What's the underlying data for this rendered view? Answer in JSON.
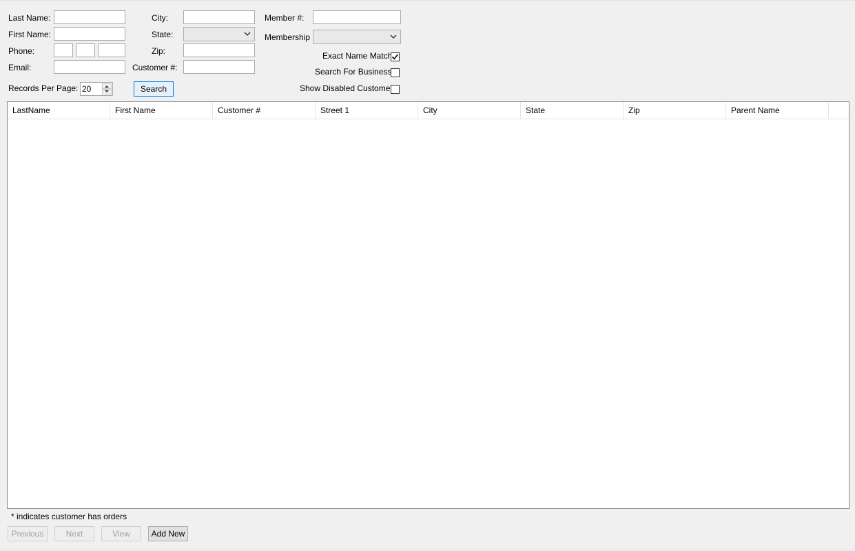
{
  "form": {
    "last_name_label": "Last Name:",
    "first_name_label": "First Name:",
    "phone_label": "Phone:",
    "email_label": "Email:",
    "city_label": "City:",
    "state_label": "State:",
    "zip_label": "Zip:",
    "customer_num_label": "Customer #:",
    "member_num_label": "Member #:",
    "membership_label": "Membership",
    "exact_name_match_label": "Exact Name Match",
    "exact_name_match_checked": true,
    "search_business_label": "Search For Business",
    "search_business_checked": false,
    "show_disabled_label": "Show Disabled Customer",
    "show_disabled_checked": false,
    "records_per_page_label": "Records Per Page:",
    "records_per_page_value": "20",
    "search_button": "Search"
  },
  "grid": {
    "columns": [
      "LastName",
      "First Name",
      "Customer #",
      "Street 1",
      "City",
      "State",
      "Zip",
      "Parent Name"
    ],
    "rows": []
  },
  "footer": {
    "note": "* indicates customer has orders",
    "previous_button": "Previous",
    "next_button": "Next",
    "view_button": "View",
    "add_new_button": "Add New"
  }
}
